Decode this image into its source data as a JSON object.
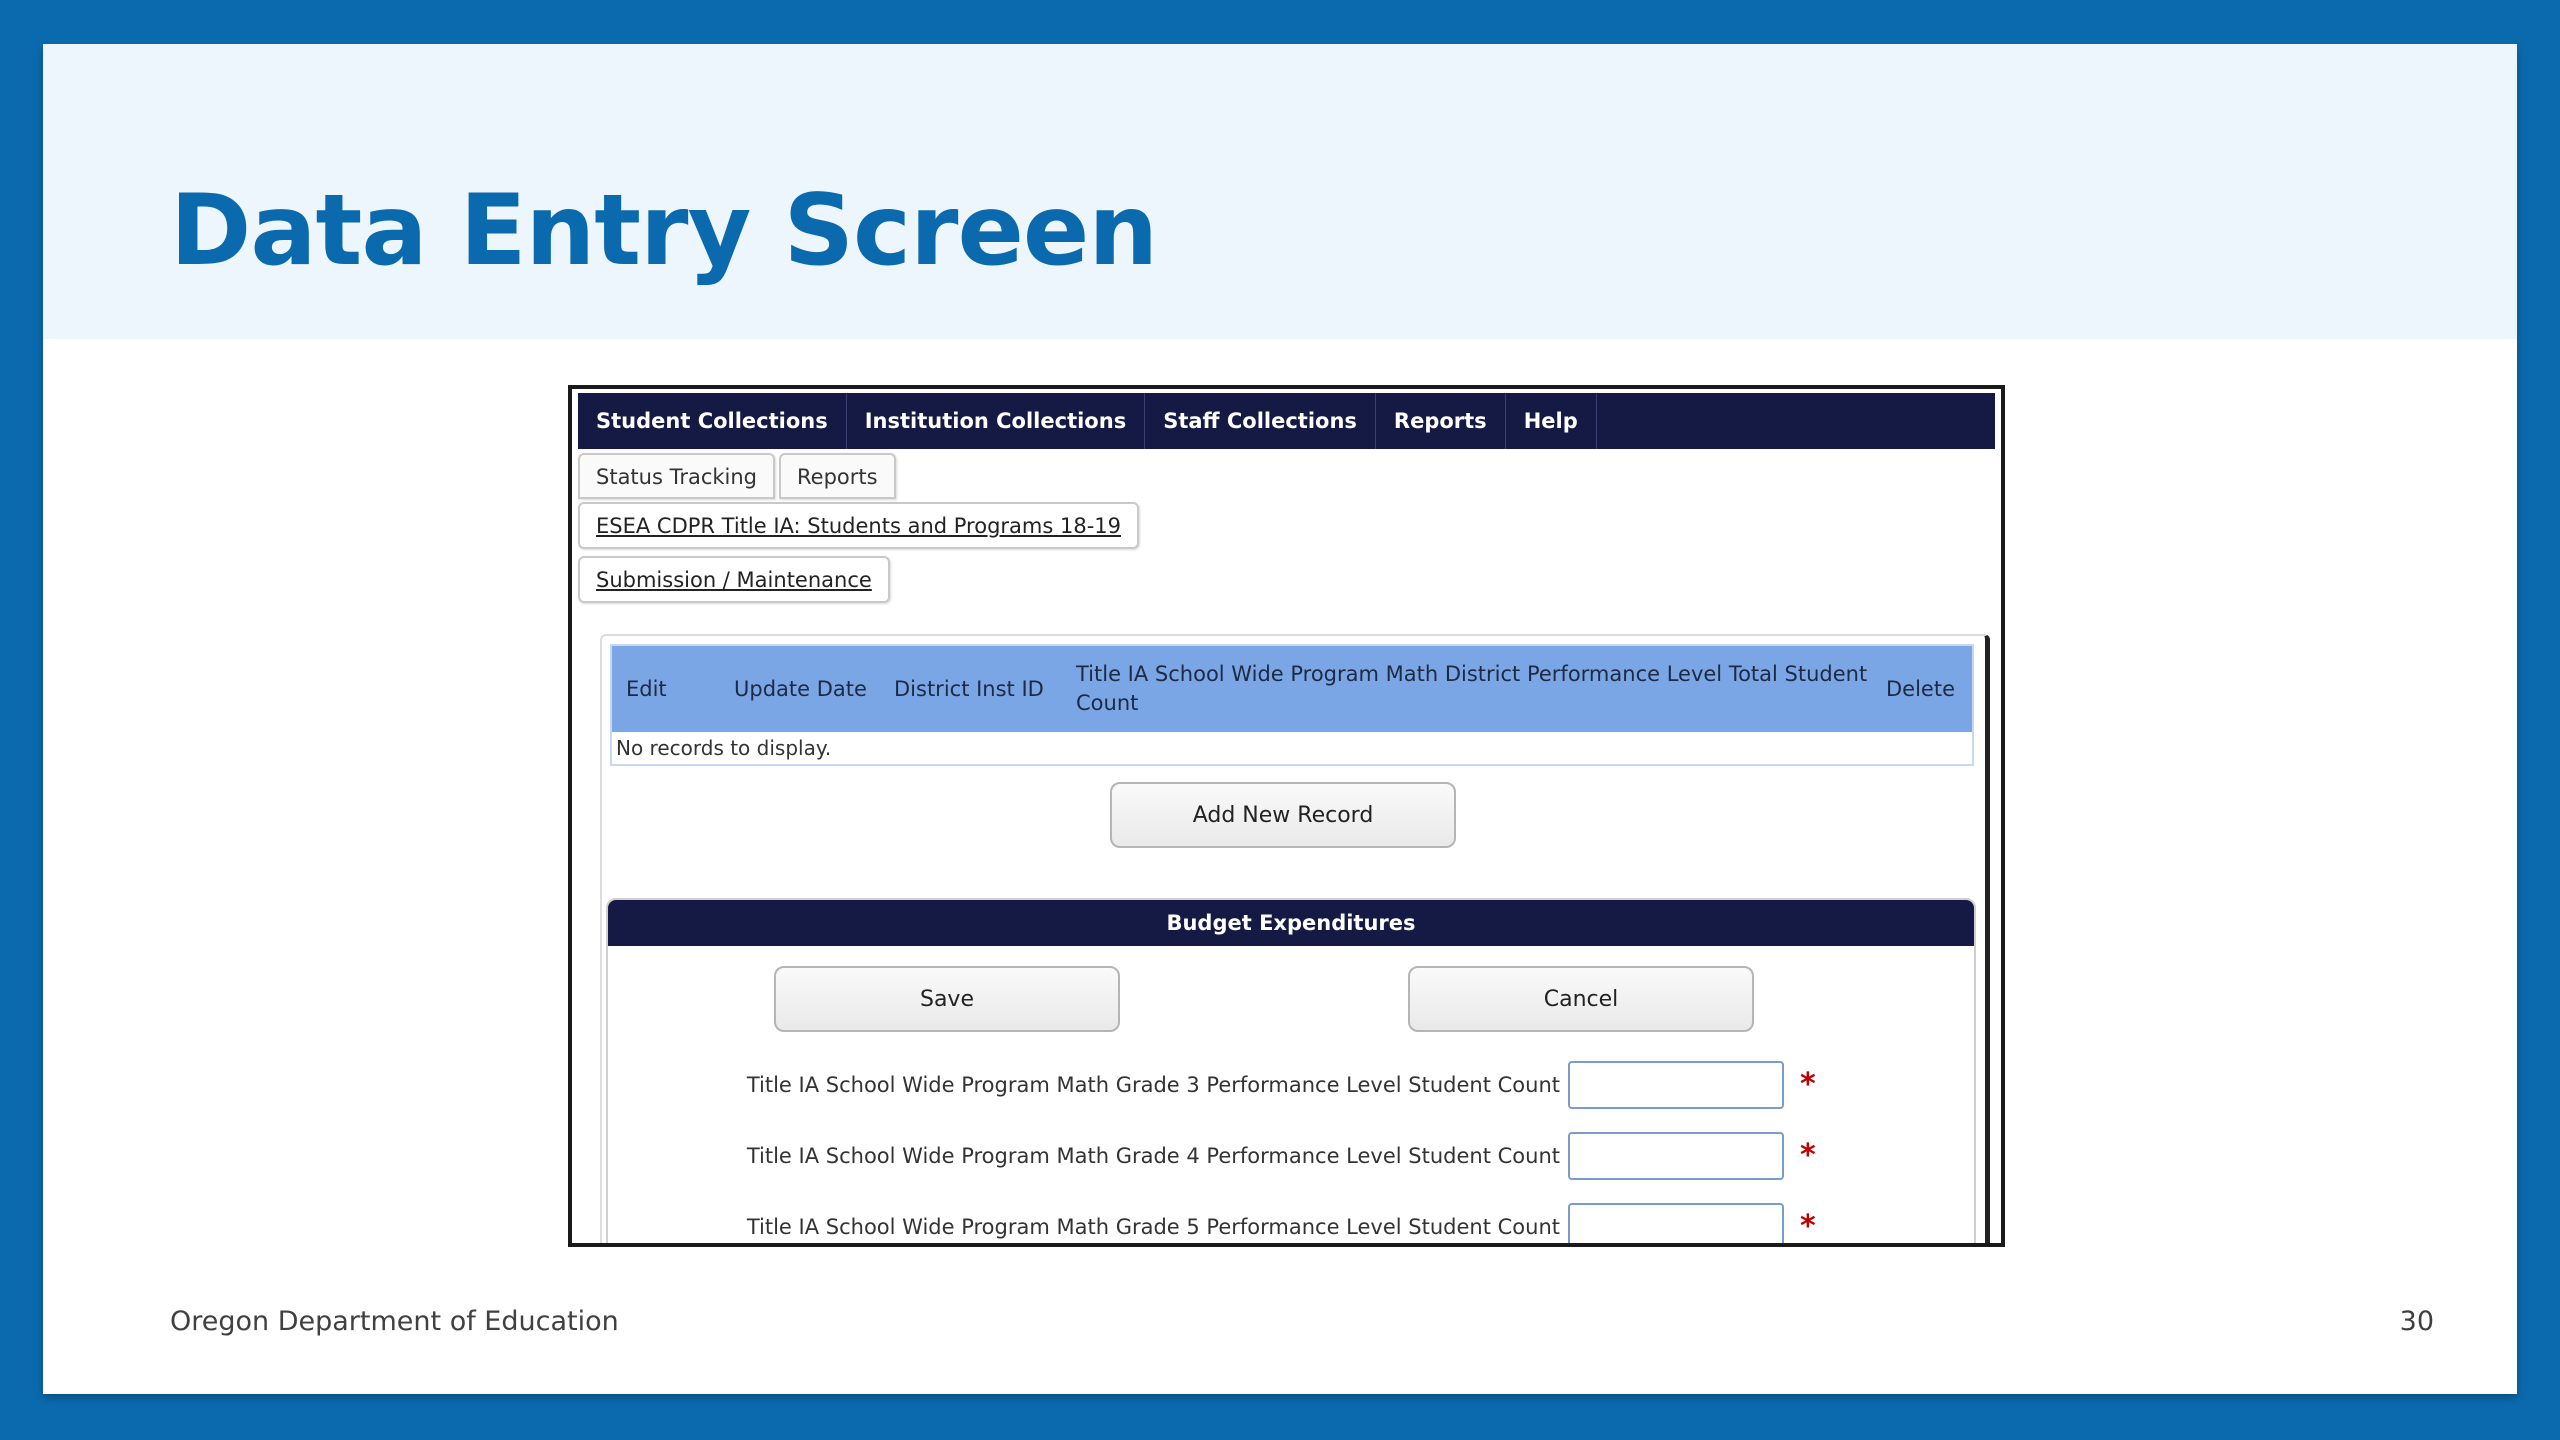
{
  "slide": {
    "title": "Data Entry Screen",
    "footer_org": "Oregon Department of Education",
    "page_number": "30"
  },
  "app": {
    "top_nav": [
      "Student Collections",
      "Institution Collections",
      "Staff Collections",
      "Reports",
      "Help"
    ],
    "tabs": [
      "Status Tracking",
      "Reports"
    ],
    "collection_link": "ESEA CDPR Title IA: Students and Programs 18-19",
    "submission_link": "Submission / Maintenance",
    "grid": {
      "columns": [
        "Edit",
        "Update Date",
        "District Inst ID",
        "Title IA School Wide Program Math District Performance Level Total Student Count",
        "Delete"
      ],
      "empty_text": "No records to display."
    },
    "add_button": "Add New Record",
    "panel": {
      "title": "Budget Expenditures",
      "save_label": "Save",
      "cancel_label": "Cancel",
      "fields": [
        {
          "label": "Title IA School Wide Program Math Grade 3 Performance Level Student Count",
          "value": "",
          "required_mark": "*"
        },
        {
          "label": "Title IA School Wide Program Math Grade 4 Performance Level Student Count",
          "value": "",
          "required_mark": "*"
        },
        {
          "label": "Title IA School Wide Program Math Grade 5 Performance Level Student Count",
          "value": "",
          "required_mark": "*"
        }
      ]
    }
  },
  "colors": {
    "brand_blue": "#0b6aae",
    "nav_navy": "#141a44",
    "grid_header": "#7aa6e6",
    "required_red": "#c00000"
  }
}
